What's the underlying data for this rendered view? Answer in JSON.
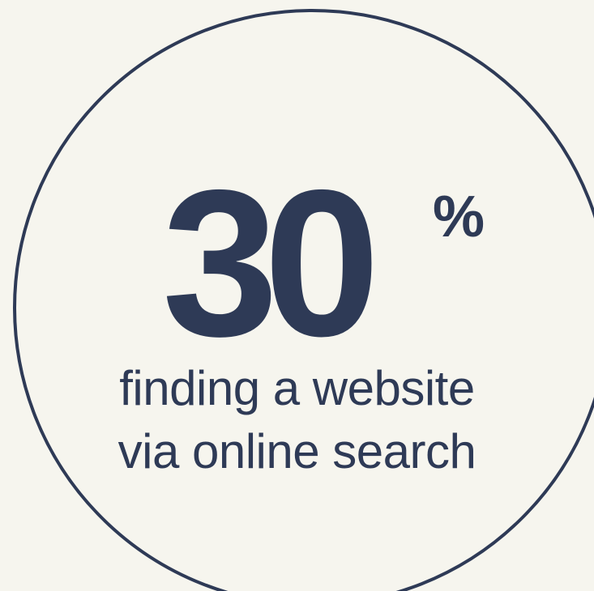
{
  "colors": {
    "background": "#f6f5ee",
    "accent": "#2e3a56"
  },
  "stat": {
    "value": "30",
    "unit": "%",
    "caption_line_1": "finding a website",
    "caption_line_2": "via online search"
  }
}
